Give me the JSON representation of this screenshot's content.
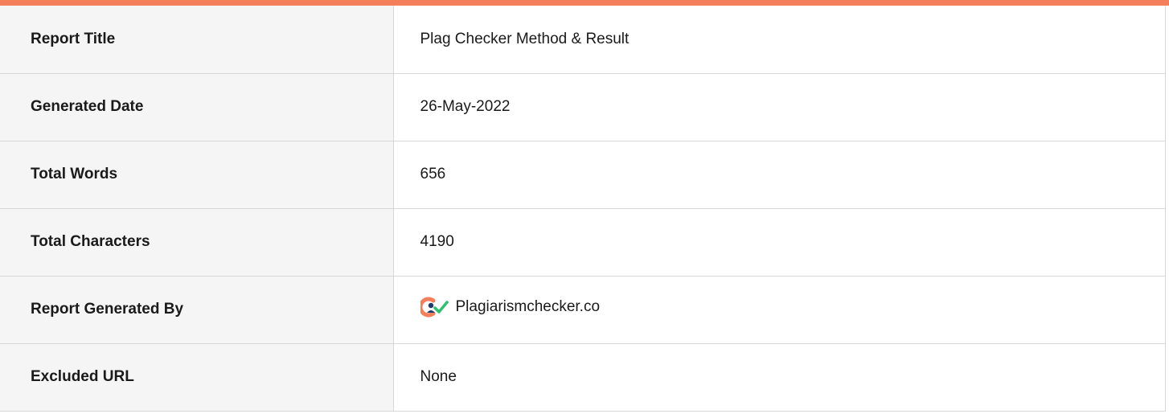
{
  "report": {
    "rows": [
      {
        "label": "Report Title",
        "value": "Plag Checker Method & Result"
      },
      {
        "label": "Generated Date",
        "value": "26-May-2022"
      },
      {
        "label": "Total Words",
        "value": "656"
      },
      {
        "label": "Total Characters",
        "value": "4190"
      },
      {
        "label": "Report Generated By",
        "value": "Plagiarismchecker.co",
        "icon": "plagiarismchecker-logo-icon"
      },
      {
        "label": "Excluded URL",
        "value": "None"
      }
    ]
  },
  "colors": {
    "accent_bar": "#f47f5a",
    "label_bg": "#f5f5f5",
    "border": "#d8d8d8",
    "logo_orange": "#f47f5a",
    "logo_navy": "#1e3a6b",
    "logo_green": "#2cc06f"
  }
}
